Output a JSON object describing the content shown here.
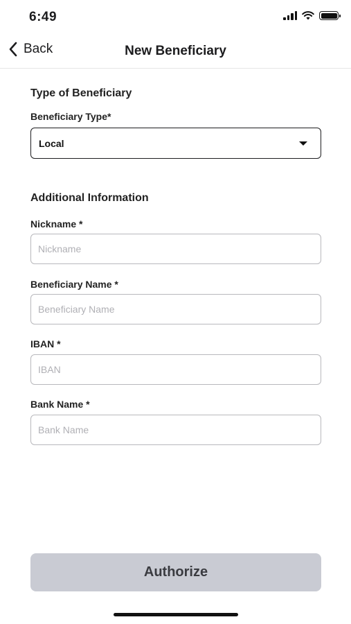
{
  "status_bar": {
    "time": "6:49",
    "icons": [
      "cellular-signal-icon",
      "wifi-icon",
      "battery-icon"
    ]
  },
  "nav": {
    "back_label": "Back",
    "back_icon": "chevron-left-icon",
    "title": "New Beneficiary"
  },
  "form": {
    "type_section_title": "Type of Beneficiary",
    "beneficiary_type": {
      "label": "Beneficiary Type*",
      "selected_value": "Local",
      "icon": "caret-down-icon"
    },
    "additional_section_title": "Additional Information",
    "nickname": {
      "label": "Nickname *",
      "value": "",
      "placeholder": "Nickname"
    },
    "beneficiary_name": {
      "label": "Beneficiary Name *",
      "value": "",
      "placeholder": "Beneficiary Name"
    },
    "iban": {
      "label": "IBAN *",
      "value": "",
      "placeholder": "IBAN"
    },
    "bank_name": {
      "label": "Bank Name *",
      "value": "",
      "placeholder": "Bank Name"
    }
  },
  "actions": {
    "authorize_label": "Authorize"
  },
  "colors": {
    "button_disabled_bg": "#c9cbd3",
    "text": "#1c1c1e",
    "input_border": "#b8b8bc"
  }
}
